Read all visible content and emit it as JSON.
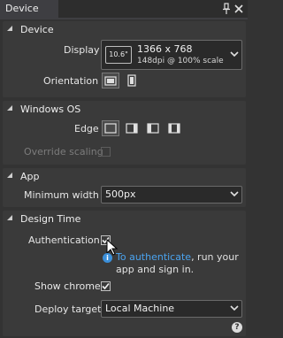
{
  "panel": {
    "tab_title": "Device"
  },
  "device": {
    "section_title": "Device",
    "display_label": "Display",
    "display_size": "10.6\"",
    "display_resolution": "1366 x 768",
    "display_scale": "148dpi @ 100% scale",
    "orientation_label": "Orientation"
  },
  "windows_os": {
    "section_title": "Windows OS",
    "edge_label": "Edge",
    "override_label": "Override scaling"
  },
  "app": {
    "section_title": "App",
    "min_width_label": "Minimum width",
    "min_width_value": "500px"
  },
  "design_time": {
    "section_title": "Design Time",
    "auth_label": "Authentication",
    "auth_link": "To authenticate",
    "auth_info_rest": ", run your",
    "auth_info_line2": "app and sign in.",
    "chrome_label": "Show chrome",
    "deploy_label": "Deploy target",
    "deploy_value": "Local Machine"
  },
  "help": {
    "glyph": "?"
  }
}
